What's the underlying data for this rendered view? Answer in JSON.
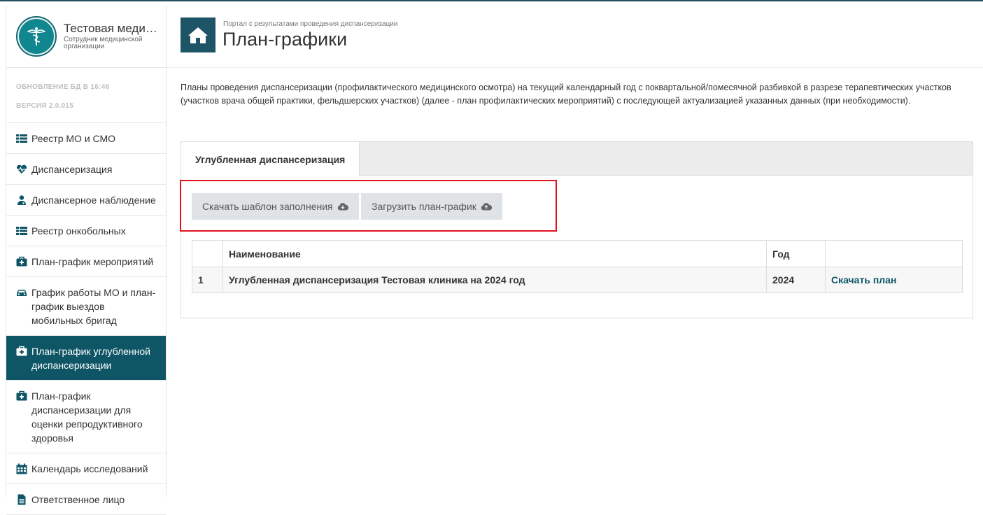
{
  "colors": {
    "accent": "#0e5565",
    "highlight": "#e0121e",
    "button_bg": "#e0e3e6"
  },
  "brand": {
    "title": "Тестовая медицинская организация",
    "subtitle": "Сотрудник медицинской организации"
  },
  "meta": {
    "db_update": "ОБНОВЛЕНИЕ БД В 16:46",
    "version": "ВЕРСИЯ 2.0.015"
  },
  "sidebar": {
    "items": [
      {
        "label": "Реестр МО и СМО",
        "icon": "list-icon"
      },
      {
        "label": "Диспансеризация",
        "icon": "heartbeat-icon"
      },
      {
        "label": "Диспансерное наблюдение",
        "icon": "user-md-icon"
      },
      {
        "label": "Реестр онкобольных",
        "icon": "list-icon"
      },
      {
        "label": "План-график мероприятий",
        "icon": "medkit-icon"
      },
      {
        "label": "График работы МО и план-график выездов мобильных бригад",
        "icon": "car-icon"
      },
      {
        "label": "План-график углубленной диспансеризации",
        "icon": "medkit-icon",
        "active": true
      },
      {
        "label": "План-график диспансеризации для оценки репродуктивного здоровья",
        "icon": "medkit-icon"
      },
      {
        "label": "Календарь исследований",
        "icon": "calendar-icon"
      },
      {
        "label": "Ответственное лицо",
        "icon": "file-icon"
      }
    ]
  },
  "header": {
    "portal": "Портал с результатами проведения диспансеризации",
    "title": "План-графики"
  },
  "description": "Планы проведения диспансеризации (профилактического медицинского осмотра) на текущий календарный год с поквартальной/помесячной разбивкой в разрезе терапевтических участков (участков врача общей практики, фельдшерских участков) (далее - план профилактических мероприятий) с последующей актуализацией указанных данных (при необходимости).",
  "tab": {
    "label": "Углубленная диспансеризация"
  },
  "buttons": {
    "download_template": "Скачать шаблон заполнения",
    "upload_plan": "Загрузить план-график"
  },
  "table": {
    "headers": [
      "",
      "Наименование",
      "Год",
      ""
    ],
    "rows": [
      {
        "num": "1",
        "name": "Углубленная диспансеризация Тестовая клиника на 2024 год",
        "year": "2024",
        "action": "Скачать план"
      }
    ]
  }
}
